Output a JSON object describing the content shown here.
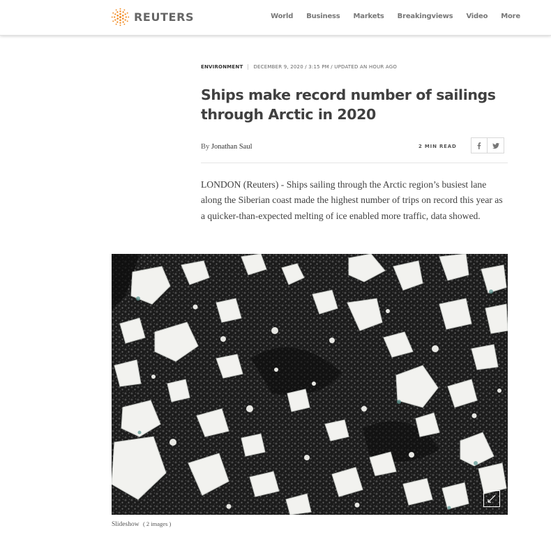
{
  "header": {
    "brand": "REUTERS",
    "logo_icon": "reuters-logo-icon",
    "nav": [
      "World",
      "Business",
      "Markets",
      "Breakingviews",
      "Video",
      "More"
    ]
  },
  "article": {
    "section": "ENVIRONMENT",
    "dateline": "DECEMBER 9, 2020 / 3:15 PM / UPDATED AN HOUR AGO",
    "headline": "Ships make record number of sailings through Arctic in 2020",
    "byline_prefix": "By",
    "author": "Jonathan Saul",
    "read_time": "2 MIN READ",
    "share_icons": [
      "facebook-icon",
      "twitter-icon"
    ],
    "lead": "LONDON (Reuters) - Ships sailing through the Arctic region’s busiest lane along the Siberian coast made the highest number of trips on record this year as a quicker-than-expected melting of ice enabled more traffic, data showed."
  },
  "media": {
    "image_subject": "aerial photo of sea ice floes on dark water",
    "expand_icon": "expand-icon",
    "slideshow_label": "Slideshow",
    "slideshow_count": "( 2 images )"
  },
  "colors": {
    "brand_orange": "#f28c24",
    "text": "#404040",
    "water": "#171717",
    "ice": "#f2f2ef"
  }
}
